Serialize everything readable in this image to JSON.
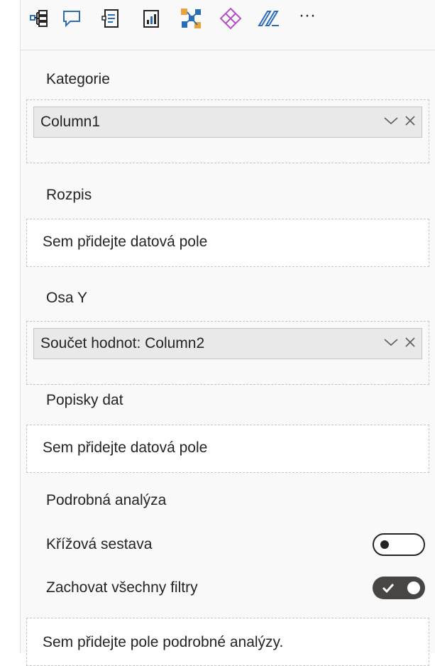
{
  "toolbar": {
    "icons": [
      "hierarchy-icon",
      "speech-bubble-icon",
      "text-document-icon",
      "chart-document-icon",
      "custom-visual-icon",
      "diamond-visual-icon",
      "chevrons-visual-icon",
      "more-options-icon"
    ],
    "more_label": "···"
  },
  "sections": {
    "kategorie": {
      "label": "Kategorie",
      "field": "Column1"
    },
    "rozpis": {
      "label": "Rozpis",
      "placeholder": "Sem přidejte datová pole"
    },
    "osa_y": {
      "label": "Osa Y",
      "field": "Součet hodnot: Column2"
    },
    "popisky_dat": {
      "label": "Popisky dat",
      "placeholder": "Sem přidejte datová pole"
    },
    "drillthrough": {
      "label": "Podrobná analýza",
      "cross_report": {
        "label": "Křížová sestava",
        "on": false
      },
      "keep_filters": {
        "label": "Zachovat všechny filtry",
        "on": true
      },
      "placeholder": "Sem přidejte pole podrobné analýzy."
    }
  },
  "colors": {
    "panel_bg": "#f9f9f9",
    "pill_bg": "#e9e9e9",
    "accent_orange": "#e8a43a",
    "accent_blue": "#2b6cb8",
    "accent_purple": "#b44fc5",
    "toggle_on": "#484644"
  }
}
